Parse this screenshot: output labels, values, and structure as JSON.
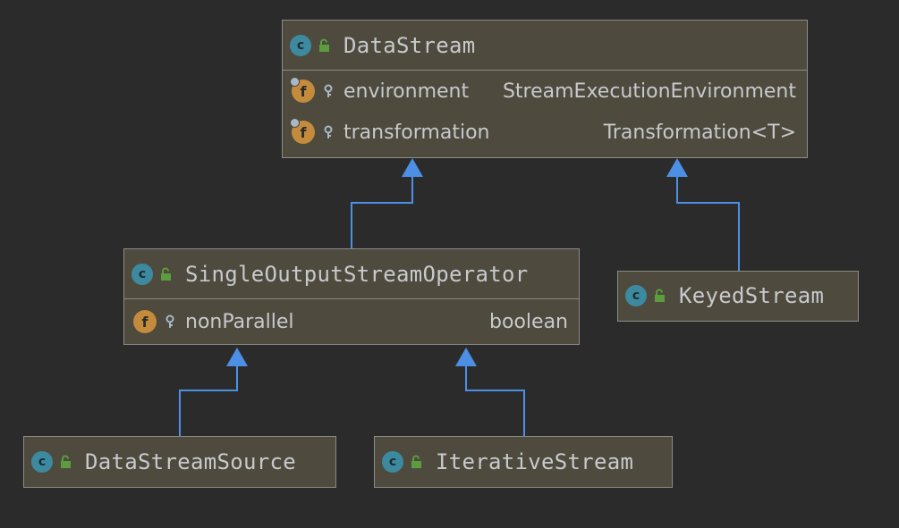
{
  "classes": {
    "datastream": {
      "name": "DataStream",
      "fields": [
        {
          "name": "environment",
          "type": "StreamExecutionEnvironment"
        },
        {
          "name": "transformation",
          "type": "Transformation<T>"
        }
      ]
    },
    "single": {
      "name": "SingleOutputStreamOperator",
      "fields": [
        {
          "name": "nonParallel",
          "type": "boolean"
        }
      ]
    },
    "keyed": {
      "name": "KeyedStream"
    },
    "source": {
      "name": "DataStreamSource"
    },
    "iterative": {
      "name": "IterativeStream"
    }
  },
  "badges": {
    "class_letter": "c",
    "field_letter": "f"
  },
  "colors": {
    "background": "#2b2b2b",
    "node_fill": "#4e4a3e",
    "node_border": "#8d8b85",
    "edge": "#4d8fe5",
    "class_badge": "#3d8aa0",
    "field_badge": "#c38b3b",
    "lock": "#5b9c3e"
  }
}
